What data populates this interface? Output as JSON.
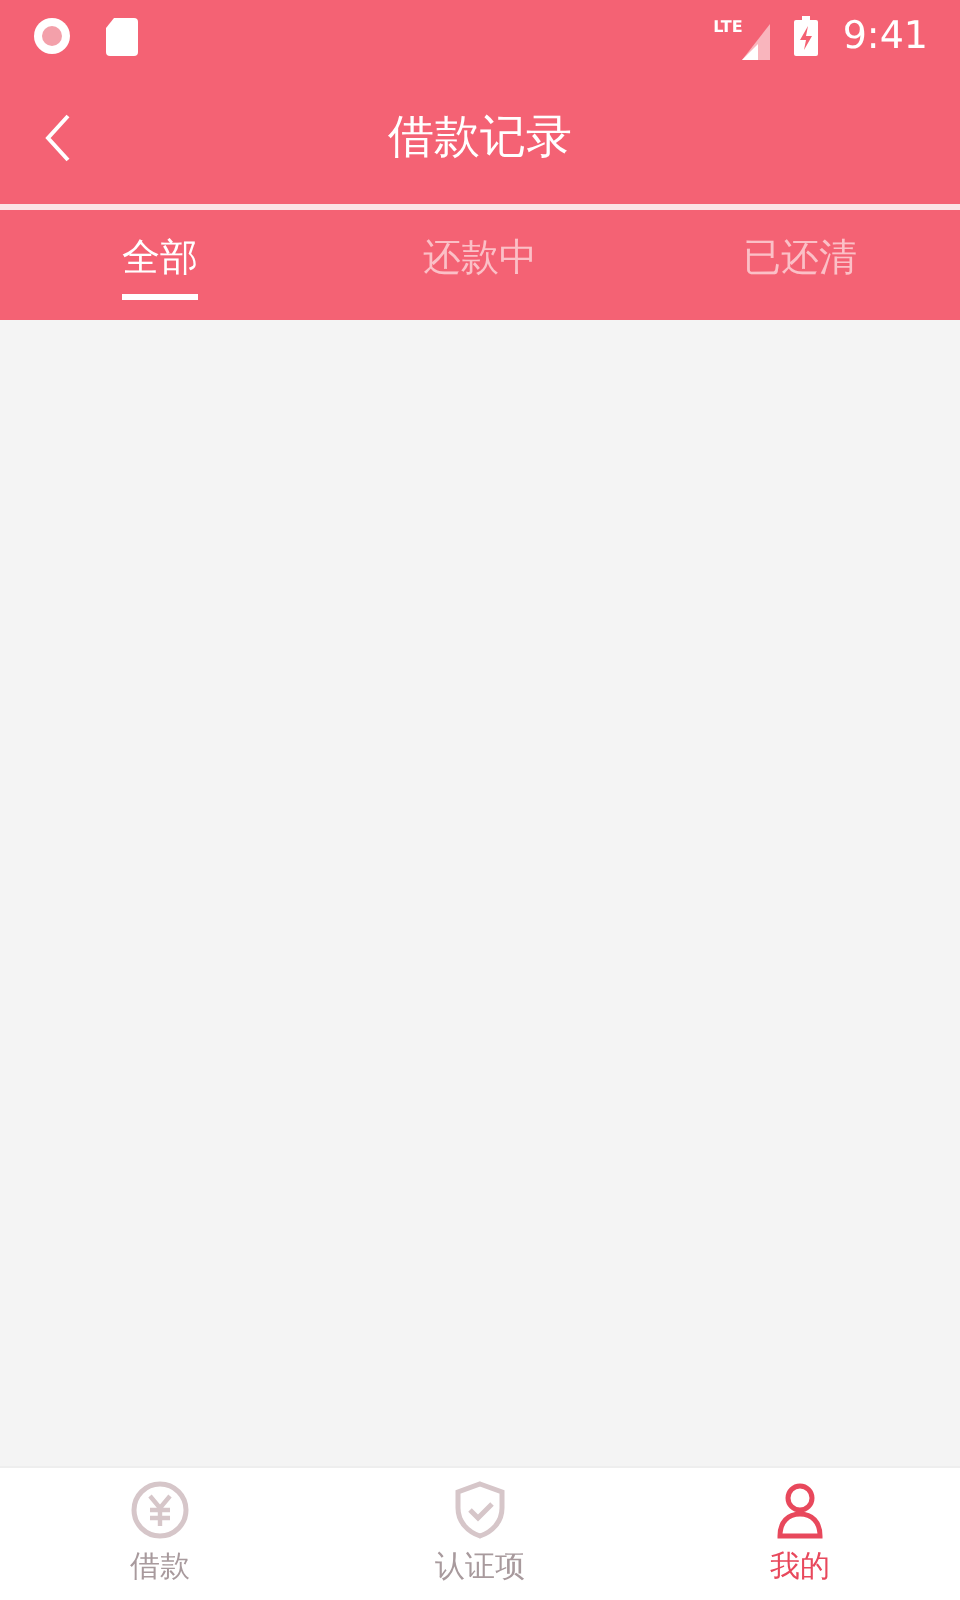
{
  "status_bar": {
    "time": "9:41",
    "network": "LTE"
  },
  "header": {
    "title": "借款记录"
  },
  "tabs": [
    {
      "label": "全部",
      "selected": true
    },
    {
      "label": "还款中",
      "selected": false
    },
    {
      "label": "已还清",
      "selected": false
    }
  ],
  "bottom_nav": [
    {
      "label": "借款",
      "kind": "loan",
      "selected": false
    },
    {
      "label": "认证项",
      "kind": "verify",
      "selected": false
    },
    {
      "label": "我的",
      "kind": "profile",
      "selected": true
    }
  ]
}
